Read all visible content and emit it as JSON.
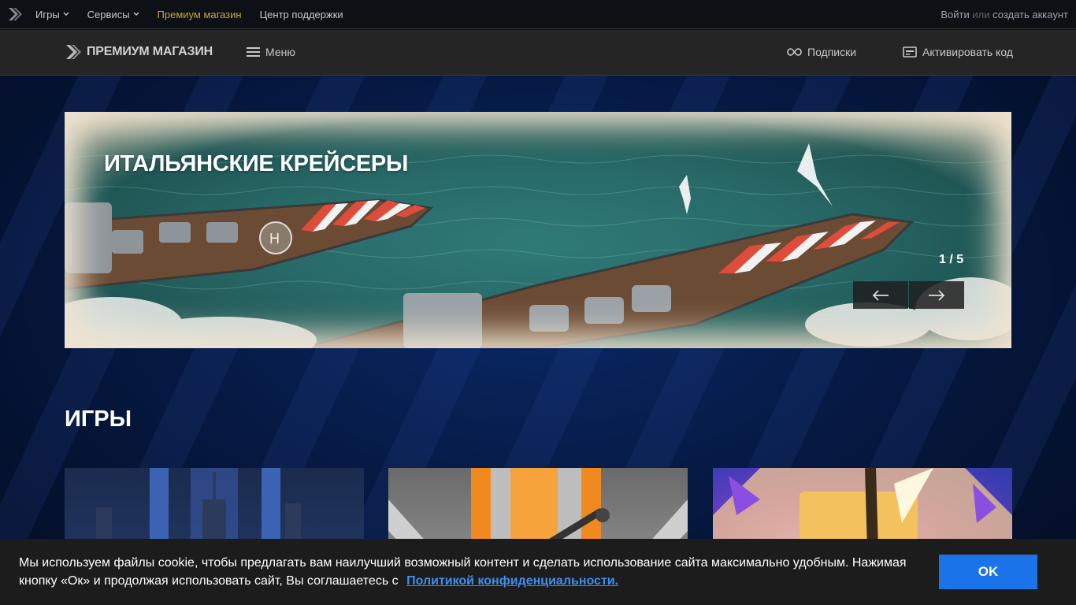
{
  "topbar": {
    "nav": [
      {
        "label": "Игры",
        "dropdown": true
      },
      {
        "label": "Сервисы",
        "dropdown": true
      },
      {
        "label": "Премиум магазин",
        "dropdown": false
      },
      {
        "label": "Центр поддержки",
        "dropdown": false
      }
    ],
    "auth": {
      "login": "Войти",
      "or": "или",
      "register": "создать аккаунт"
    }
  },
  "store": {
    "logo_text": "ПРЕМИУМ МАГАЗИН",
    "menu_label": "Меню",
    "subscriptions_label": "Подписки",
    "activate_label": "Активировать код"
  },
  "banner": {
    "title": "ИТАЛЬЯНСКИЕ КРЕЙСЕРЫ",
    "counter": "1 / 5"
  },
  "games": {
    "title": "ИГРЫ",
    "cards": [
      {
        "icon": "world-of-warships-art"
      },
      {
        "icon": "world-of-tanks-art"
      },
      {
        "icon": "world-of-warplanes-art"
      }
    ]
  },
  "cookie": {
    "message": "Мы используем файлы cookie, чтобы предлагать вам наилучший возможный контент и сделать использование сайта максимально удобным. Нажимая кнопку «Ок» и продолжая использовать сайт, Вы соглашаетесь с",
    "policy_link": "Политикой конфиденциальности.",
    "ok_label": "OK"
  },
  "colors": {
    "accent_gold": "#c9a14a",
    "ok_button": "#1a73e8",
    "link_blue": "#3d8ff0"
  }
}
